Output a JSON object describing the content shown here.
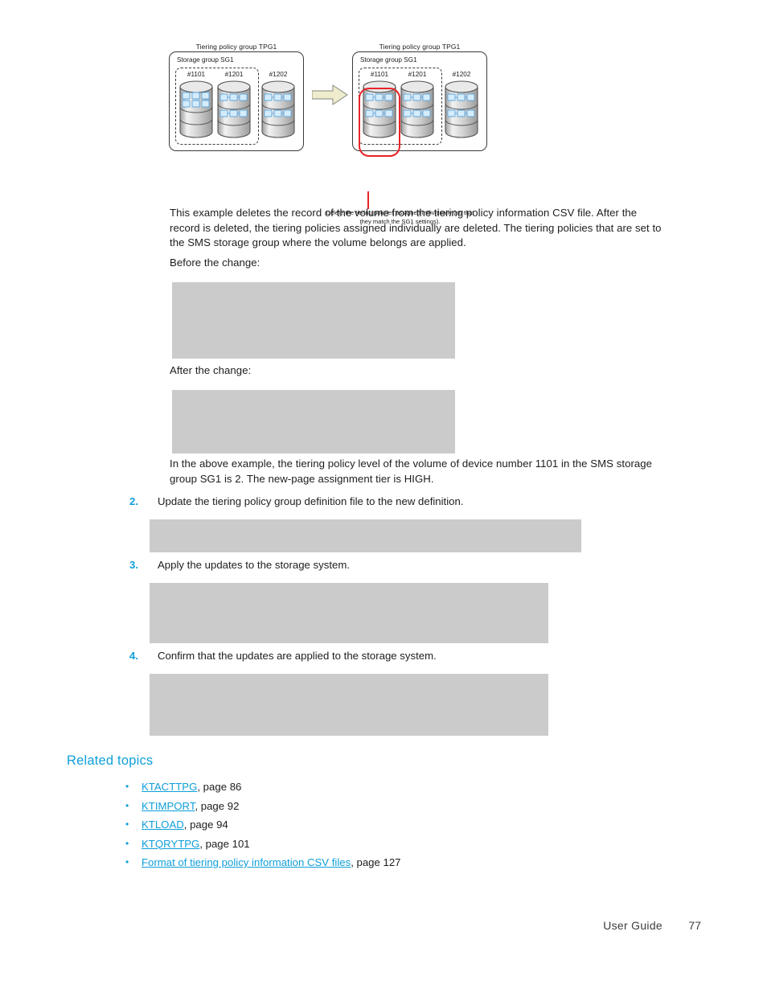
{
  "figure": {
    "panels": [
      {
        "id": "before",
        "tpg_title": "Tiering policy group TPG1",
        "sg_label": "Storage group SG1",
        "volumes": [
          {
            "label": "#1101",
            "highlighted": false,
            "tier_rows": 2,
            "dense": true
          },
          {
            "label": "#1201",
            "highlighted": false,
            "tier_rows": 2,
            "dense": false
          },
          {
            "label": "#1202",
            "highlighted": false,
            "tier_rows": 2,
            "dense": false
          }
        ]
      },
      {
        "id": "after",
        "tpg_title": "Tiering policy group TPG1",
        "sg_label": "Storage group SG1",
        "volumes": [
          {
            "label": "#1101",
            "highlighted": true,
            "tier_rows": 2,
            "dense": false
          },
          {
            "label": "#1201",
            "highlighted": false,
            "tier_rows": 2,
            "dense": false
          },
          {
            "label": "#1202",
            "highlighted": false,
            "tier_rows": 2,
            "dense": false
          }
        ]
      }
    ],
    "arrow": "right-arrow",
    "callout": "Delete the tiering policies assigned individually (so that they match the SG1 settings).",
    "colors": {
      "highlight": "#e8242a",
      "arrow_fill": "#eeeccd",
      "tier_block": "#d6ecfb"
    }
  },
  "body": {
    "intro_paragraph": "This example deletes the record of the volume from the tiering policy information CSV file. After the record is deleted, the tiering policies assigned individually are deleted. The tiering policies that are set to the SMS storage group where the volume belongs are applied.",
    "before_label": "Before the change:",
    "after_label": "After the change:",
    "summary_paragraph": "In the above example, the tiering policy level of the volume of device number 1101 in the SMS storage group SG1 is 2. The new-page assignment tier is HIGH."
  },
  "steps": [
    {
      "number": "2.",
      "text": "Update the tiering policy group definition file to the new definition."
    },
    {
      "number": "3.",
      "text": "Apply the updates to the storage system."
    },
    {
      "number": "4.",
      "text": "Confirm that the updates are applied to the storage system."
    }
  ],
  "related": {
    "heading": "Related topics",
    "items": [
      {
        "bullet": "•",
        "link": "KTACTTPG",
        "suffix": ", page 86"
      },
      {
        "bullet": "•",
        "link": "KTIMPORT",
        "suffix": ", page 92"
      },
      {
        "bullet": "•",
        "link": "KTLOAD",
        "suffix": ", page 94"
      },
      {
        "bullet": "•",
        "link": "KTQRYTPG",
        "suffix": ", page 101"
      },
      {
        "bullet": "•",
        "link": "Format of tiering policy information CSV files",
        "suffix": ", page 127"
      }
    ]
  },
  "footer": {
    "label": "User Guide",
    "page": "77"
  },
  "colors": {
    "accent": "#0f9fd8",
    "code_block": "#cbcbcb",
    "text": "#1d1d1d"
  }
}
